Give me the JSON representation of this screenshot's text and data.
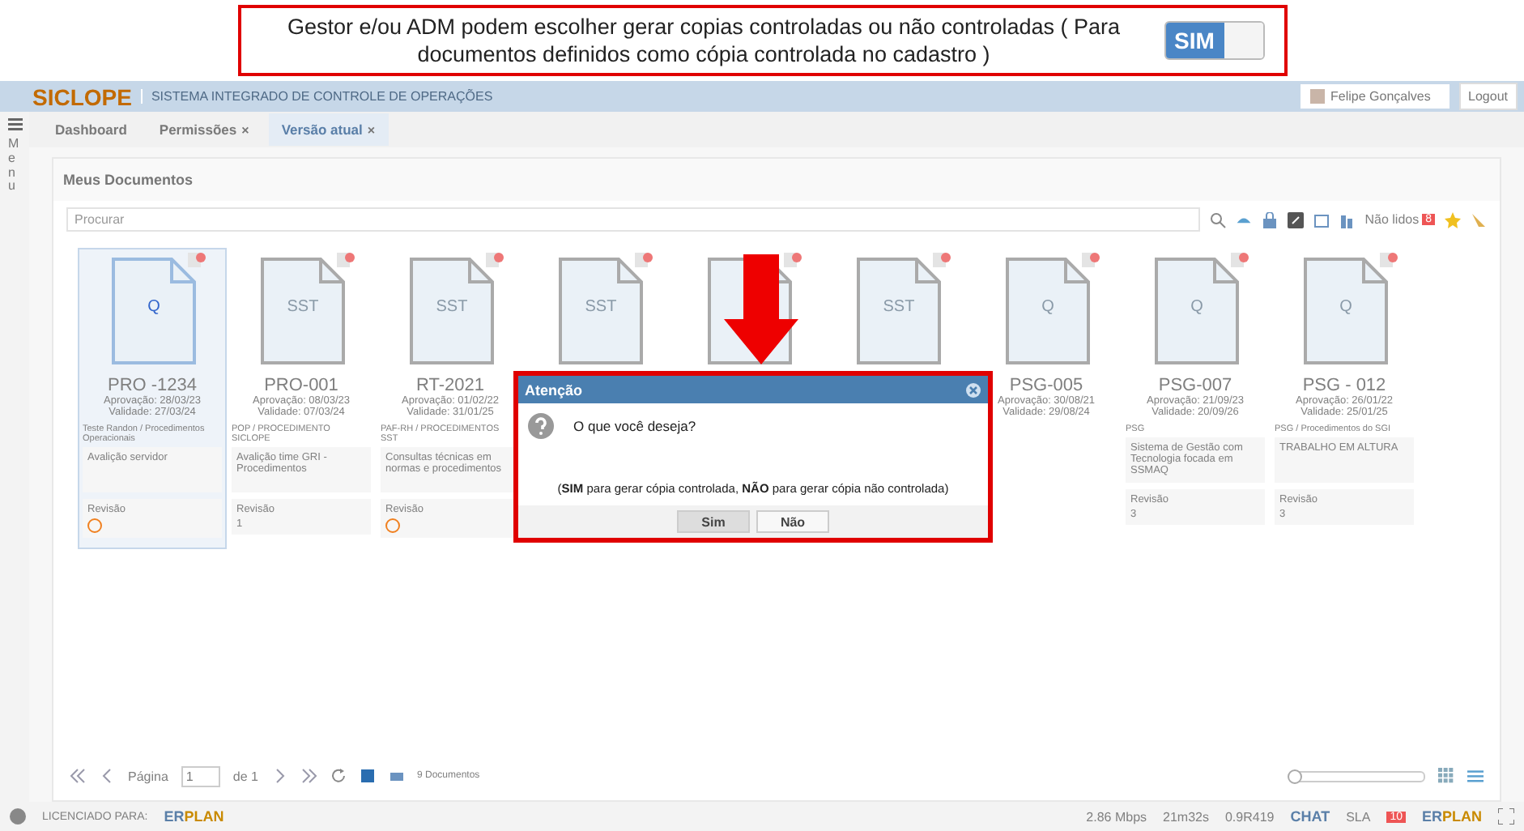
{
  "banner": {
    "text": "Gestor e/ou ADM podem escolher gerar copias controladas ou não controladas ( Para documentos definidos como cópia controlada no cadastro )",
    "toggle": {
      "label": "SIM",
      "on": true
    }
  },
  "header": {
    "logo": "SICLOPE",
    "subtitle": "SISTEMA INTEGRADO DE CONTROLE DE OPERAÇÕES",
    "user": "Felipe Gonçalves",
    "logout": "Logout"
  },
  "sidebar": {
    "label": "Menu"
  },
  "tabs": [
    {
      "label": "Dashboard",
      "selected": false
    },
    {
      "label": "Permissões",
      "selected": false,
      "close": "×"
    },
    {
      "label": "Versão atual",
      "selected": true,
      "close": "×"
    }
  ],
  "panel": {
    "title": "Meus Documentos",
    "search": {
      "placeholder": "Procurar"
    },
    "unread": {
      "label": "Não lidos",
      "count": "8"
    }
  },
  "documents": [
    {
      "icon_label": "Q",
      "selected": true,
      "code": "PRO -1234",
      "approval": "Aprovação: 28/03/23",
      "validity": "Validade: 27/03/24",
      "category": "Teste Randon / Procedimentos Operacionais",
      "description": "Avalição servidor",
      "revision_label": "Revisão",
      "revision": {
        "kind": "icon"
      }
    },
    {
      "icon_label": "SST",
      "selected": false,
      "code": "PRO-001",
      "approval": "Aprovação: 08/03/23",
      "validity": "Validade: 07/03/24",
      "category": "POP / PROCEDIMENTO SICLOPE",
      "description": "Avalição time GRI - Procedimentos",
      "revision_label": "Revisão",
      "revision": {
        "kind": "text",
        "value": "1"
      }
    },
    {
      "icon_label": "SST",
      "selected": false,
      "code": "RT-2021",
      "approval": "Aprovação: 01/02/22",
      "validity": "Validade: 31/01/25",
      "category": "PAF-RH / PROCEDIMENTOS SST",
      "description": "Consultas técnicas em normas e procedimentos",
      "revision_label": "Revisão",
      "revision": {
        "kind": "icon"
      }
    },
    {
      "icon_label": "SST",
      "selected": false
    },
    {
      "selected": false
    },
    {
      "icon_label": "SST",
      "selected": false
    },
    {
      "icon_label": "Q",
      "selected": false,
      "code": "PSG-005",
      "approval": "Aprovação: 30/08/21",
      "validity": "Validade: 29/08/24"
    },
    {
      "icon_label": "Q",
      "selected": false,
      "code": "PSG-007",
      "approval": "Aprovação: 21/09/23",
      "validity": "Validade: 20/09/26",
      "category": "PSG",
      "description": "Sistema de Gestão com Tecnologia focada em SSMAQ",
      "revision_label": "Revisão",
      "revision": {
        "kind": "text",
        "value": "3"
      }
    },
    {
      "icon_label": "Q",
      "selected": false,
      "code": "PSG - 012",
      "approval": "Aprovação: 26/01/22",
      "validity": "Validade: 25/01/25",
      "category": "PSG / Procedimentos do SGI",
      "description": "TRABALHO EM ALTURA",
      "revision_label": "Revisão",
      "revision": {
        "kind": "text",
        "value": "3"
      }
    }
  ],
  "pager": {
    "page_label": "Página",
    "page": "1",
    "of": "de 1",
    "count": "9 Documentos",
    "zoom": {
      "level": 0
    }
  },
  "footer": {
    "licensed": "LICENCIADO PARA:",
    "brand": [
      "ER",
      "PLAN"
    ],
    "speed": "2.86 Mbps",
    "time": "21m32s",
    "version": "0.9R419",
    "chat": "CHAT",
    "sla": "SLA",
    "notifications": "10",
    "brand_right": [
      "ER",
      "PLAN"
    ]
  },
  "dialog": {
    "title": "Atenção",
    "question": "O que você deseja?",
    "message": "(**SIM** para gerar cópia controlada, **NÃO** para gerar cópia não controlada)",
    "buttons": [
      {
        "label": "Sim",
        "selected": true
      },
      {
        "label": "Não",
        "selected": false
      }
    ]
  }
}
